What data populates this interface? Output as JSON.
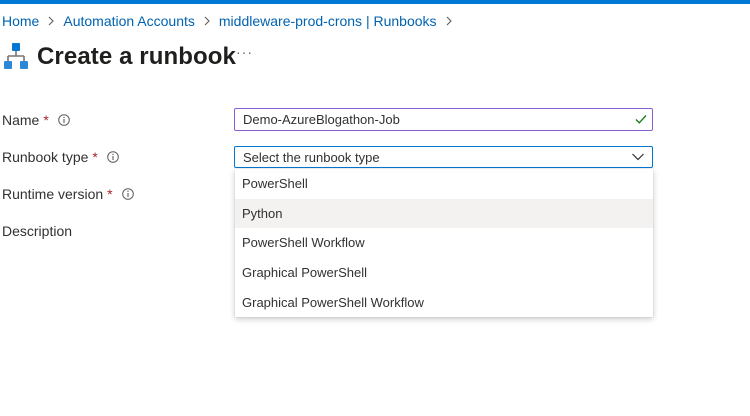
{
  "breadcrumb": {
    "items": [
      "Home",
      "Automation Accounts",
      "middleware-prod-crons | Runbooks"
    ]
  },
  "page": {
    "title": "Create a runbook",
    "more": "···"
  },
  "form": {
    "name_label": "Name",
    "name_value": "Demo-AzureBlogathon-Job",
    "runbook_type_label": "Runbook type",
    "runbook_type_placeholder": "Select the runbook type",
    "runtime_label": "Runtime version",
    "description_label": "Description",
    "required_mark": "*"
  },
  "dropdown": {
    "options": [
      "PowerShell",
      "Python",
      "PowerShell Workflow",
      "Graphical PowerShell",
      "Graphical PowerShell Workflow"
    ],
    "highlighted": "Python"
  },
  "colors": {
    "accent": "#0078d4",
    "link": "#0063b1",
    "required": "#a4262c",
    "valid_border": "#8a5fd6",
    "check": "#107c10"
  },
  "icons": [
    "breadcrumb-chevron-icon",
    "runbook-icon",
    "info-icon",
    "checkmark-icon",
    "chevron-down-icon"
  ]
}
